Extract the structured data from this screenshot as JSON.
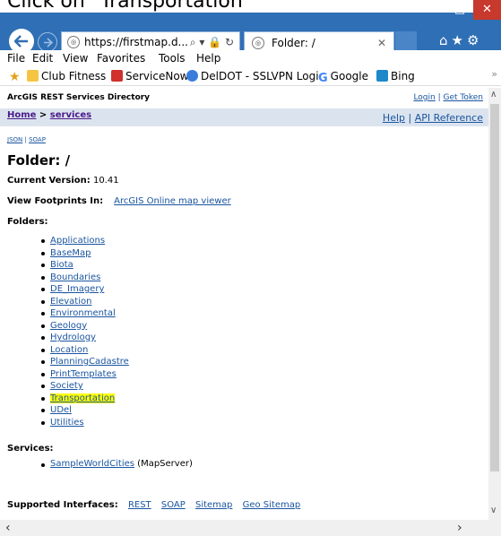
{
  "caption": "Click on \"Transportation\"",
  "browser": {
    "url": "https://firstmap.d...",
    "tab_title": "Folder: /",
    "menu": [
      "File",
      "Edit",
      "View",
      "Favorites",
      "Tools",
      "Help"
    ],
    "favorites": [
      "Club Fitness",
      "ServiceNow",
      "DelDOT - SSLVPN Login",
      "Google",
      "Bing"
    ]
  },
  "page": {
    "directory_title": "ArcGIS REST Services Directory",
    "login": "Login",
    "get_token": "Get Token",
    "breadcrumb_home": "Home",
    "breadcrumb_sep": " > ",
    "breadcrumb_services": "services",
    "help": "Help",
    "api_reference": "API Reference",
    "json": "JSON",
    "soap": "SOAP",
    "folder_title": "Folder: /",
    "current_version_label": "Current Version:",
    "current_version": "10.41",
    "view_footprints_label": "View Footprints In:",
    "map_viewer": "ArcGIS Online map viewer",
    "folders_label": "Folders:",
    "folders": [
      "Applications",
      "BaseMap",
      "Biota",
      "Boundaries",
      "DE_Imagery",
      "Elevation",
      "Environmental",
      "Geology",
      "Hydrology",
      "Location",
      "PlanningCadastre",
      "PrintTemplates",
      "Society",
      "Transportation",
      "UDel",
      "Utilities"
    ],
    "highlighted_folder": "Transportation",
    "services_label": "Services:",
    "service_name": "SampleWorldCities",
    "service_type": "(MapServer)",
    "supported_interfaces_label": "Supported Interfaces:",
    "interfaces": [
      "REST",
      "SOAP",
      "Sitemap",
      "Geo Sitemap"
    ]
  },
  "colors": {
    "titlebar": "#2f6fb5",
    "link": "#1a55a0",
    "highlight": "#ffff00",
    "breadcrumb_bg": "#dbe4ee"
  }
}
